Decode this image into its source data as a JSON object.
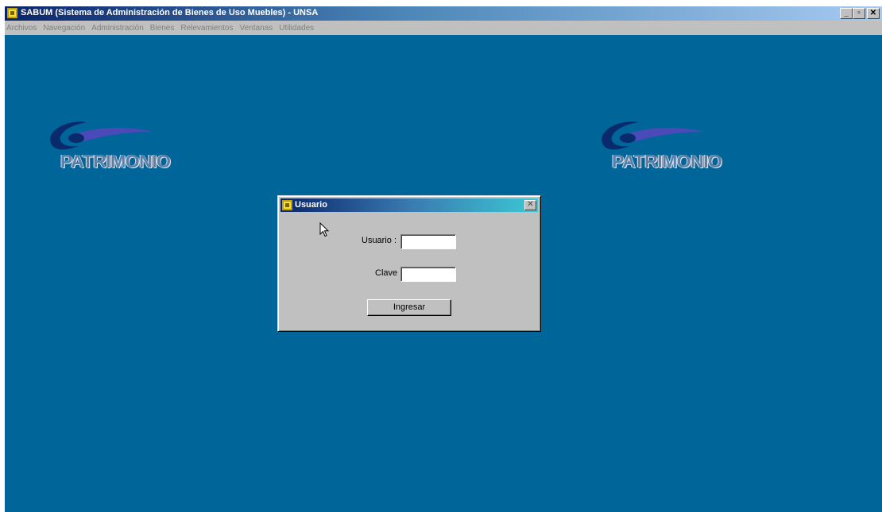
{
  "window": {
    "title": "SABUM (Sistema de Administración de Bienes de Uso Muebles) - UNSA",
    "controls": {
      "minimize": "_",
      "maximize": "▫",
      "close": "✕"
    }
  },
  "menu": [
    {
      "label": "Archivos"
    },
    {
      "label": "Navegación"
    },
    {
      "label": "Administración"
    },
    {
      "label": "Bienes"
    },
    {
      "label": "Relevamientos"
    },
    {
      "label": "Ventanas"
    },
    {
      "label": "Utilidades"
    }
  ],
  "logos": [
    {
      "text": "PATRIMONIO"
    },
    {
      "text": "PATRIMONIO"
    }
  ],
  "dialog": {
    "title": "Usuario",
    "close": "✕",
    "usuario_label": "Usuario :",
    "usuario_value": "",
    "clave_label": "Clave :",
    "clave_value": "",
    "submit_label": "Ingresar"
  },
  "colors": {
    "desktop": "#006699",
    "logo_text": "#5a7fa8",
    "menu_disabled_text": "#808080"
  },
  "icons": {
    "app": "app-icon",
    "dialog": "app-icon",
    "cursor": "mouse-pointer-icon"
  }
}
